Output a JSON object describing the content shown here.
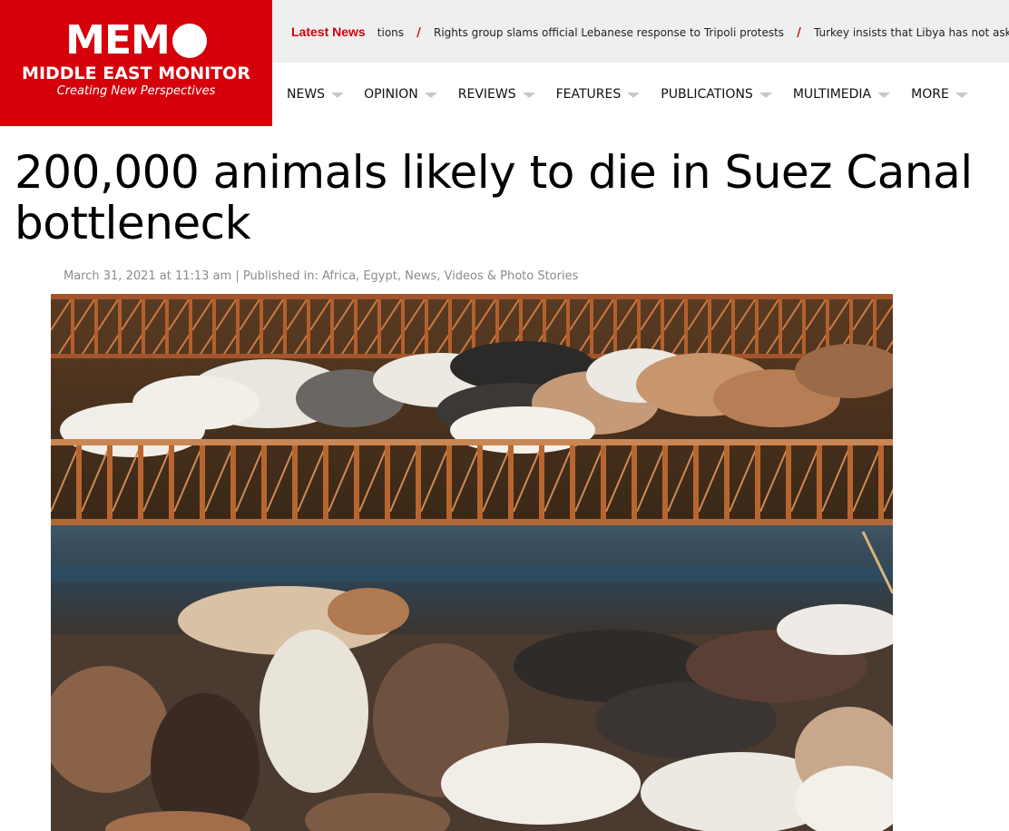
{
  "logo": {
    "brand": "MEM",
    "name": "MIDDLE EAST MONITOR",
    "tagline": "Creating New Perspectives"
  },
  "ticker": {
    "label": "Latest News",
    "items": [
      "tions",
      "Rights group slams official Lebanese response to Tripoli protests",
      "Turkey insists that Libya has not asked to"
    ]
  },
  "nav": {
    "items": [
      "NEWS",
      "OPINION",
      "REVIEWS",
      "FEATURES",
      "PUBLICATIONS",
      "MULTIMEDIA",
      "MORE"
    ]
  },
  "article": {
    "title": "200,000 animals likely to die in Suez Canal bottleneck",
    "date": "March 31, 2021 at 11:13 am",
    "meta_separator": "|",
    "published_label": "Published in:",
    "categories": [
      "Africa",
      "Egypt",
      "News",
      "Videos & Photo Stories"
    ]
  },
  "colors": {
    "brand_red": "#d6000b",
    "ticker_bg": "#efefef",
    "meta_text": "#8b8b8b"
  }
}
